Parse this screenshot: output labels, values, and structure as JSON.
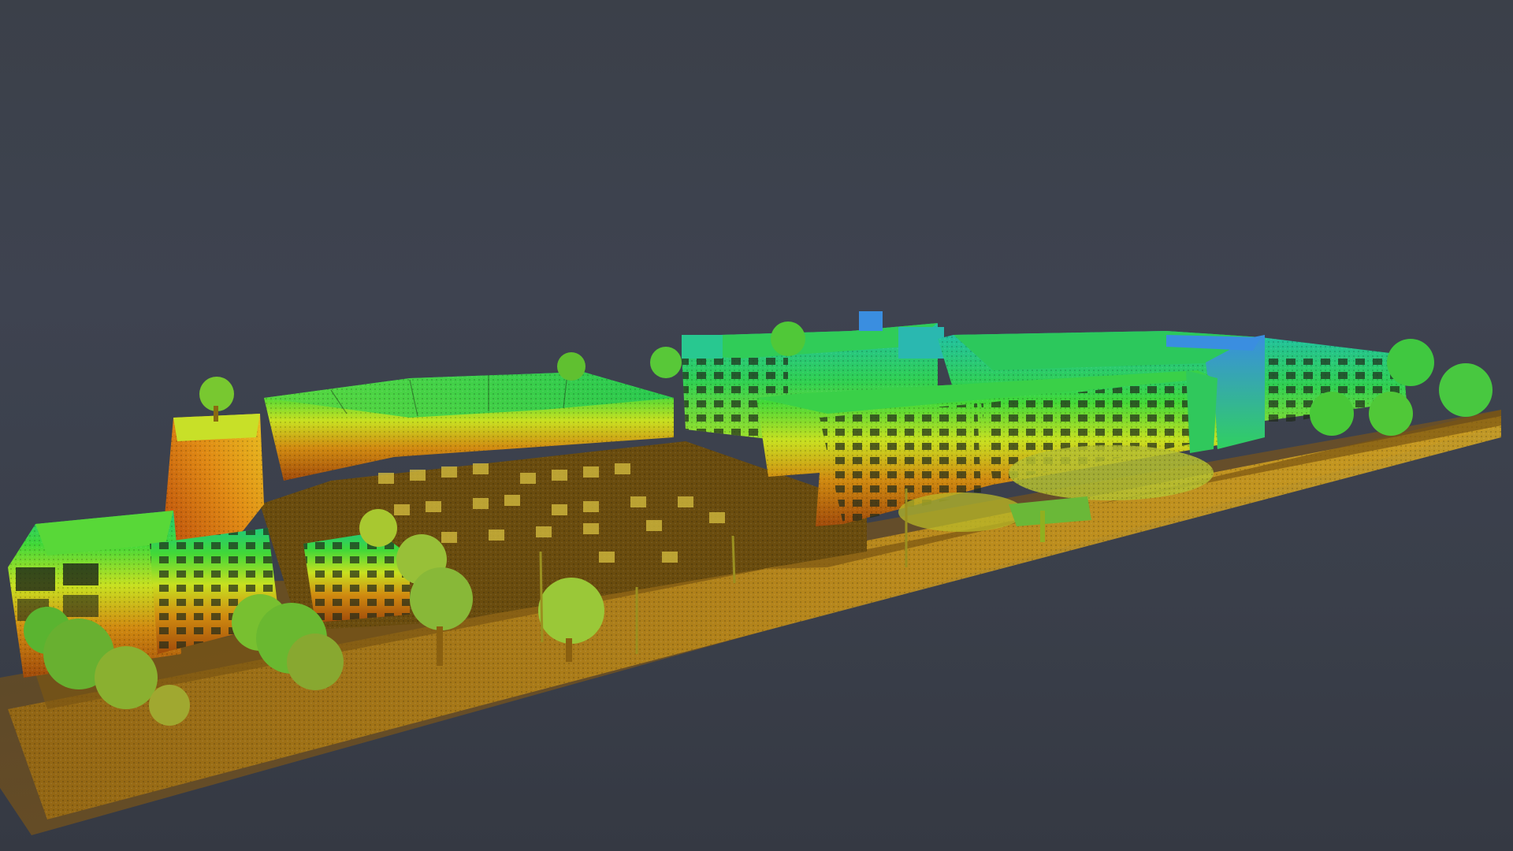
{
  "scene": {
    "subject": "point-cloud-industrial-site",
    "colormap": [
      "#a04a0a",
      "#d07a10",
      "#e8c020",
      "#b8e020",
      "#60e030",
      "#20d060",
      "#20c0b0",
      "#3090e0"
    ],
    "background_color": "#3d424c"
  }
}
